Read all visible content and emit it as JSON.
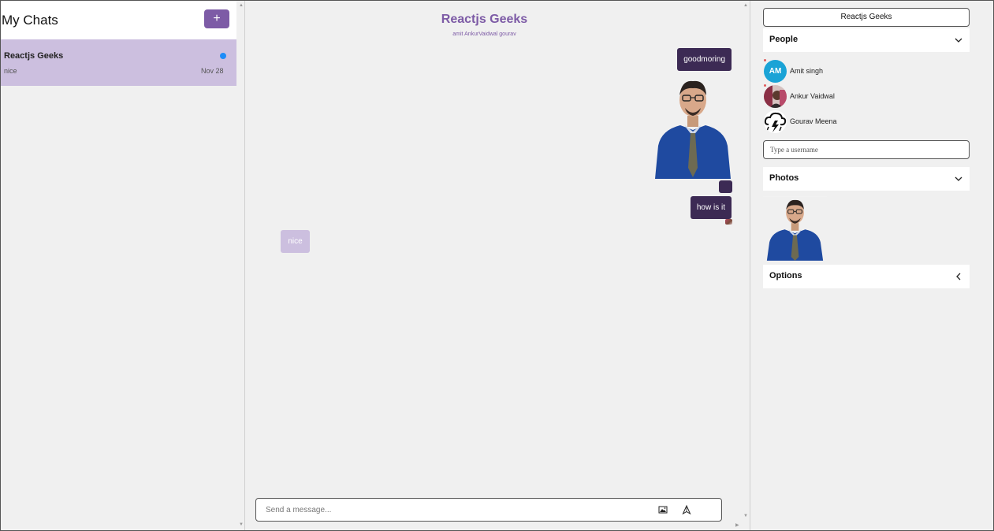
{
  "sidebar": {
    "title": "My Chats",
    "add_label": "+",
    "chats": [
      {
        "title": "Reactjs Geeks",
        "last_message": "nice",
        "date": "Nov 28",
        "unread": true
      }
    ]
  },
  "chat": {
    "title": "Reactjs Geeks",
    "members_line": "amit AnkurVaidwal gourav",
    "messages": [
      {
        "sender": "me",
        "type": "text",
        "text": "goodmoring"
      },
      {
        "sender": "me",
        "type": "image",
        "alt": "photo of a man in blue shirt and tie"
      },
      {
        "sender": "me",
        "type": "text",
        "text": ""
      },
      {
        "sender": "me",
        "type": "text",
        "text": "how is it"
      },
      {
        "sender": "other",
        "type": "text",
        "text": "nice"
      }
    ],
    "composer": {
      "placeholder": "Send a message...",
      "value": ""
    }
  },
  "settings": {
    "chat_name": "Reactjs Geeks",
    "people_label": "People",
    "people": [
      {
        "name": "Amit singh",
        "initials": "AM",
        "avatar_color": "#1aa3d6"
      },
      {
        "name": "Ankur Vaidwal",
        "initials": "",
        "avatar_color": ""
      },
      {
        "name": "Gourav Meena",
        "initials": "",
        "avatar_color": ""
      }
    ],
    "username_placeholder": "Type a username",
    "photos_label": "Photos",
    "options_label": "Options"
  },
  "colors": {
    "accent": "#7d5ba6",
    "my_bubble": "#3c2a54",
    "their_bubble": "#ccbfdf",
    "unread_dot": "#1d8cf8"
  }
}
